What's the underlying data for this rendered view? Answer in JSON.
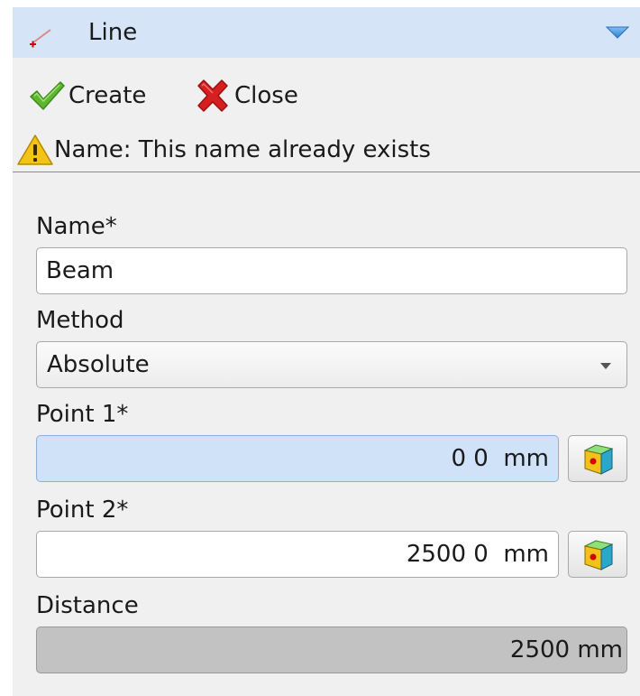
{
  "header": {
    "title": "Line",
    "icon": "line-icon",
    "collapse_icon": "collapse-arrow-icon"
  },
  "toolbar": {
    "create_label": "Create",
    "close_label": "Close"
  },
  "warning": {
    "text": "Name: This name already exists",
    "icon": "warning-icon"
  },
  "form": {
    "name": {
      "label": "Name*",
      "value": "Beam"
    },
    "method": {
      "label": "Method",
      "selected": "Absolute"
    },
    "point1": {
      "label": "Point 1*",
      "value": "0 0  mm"
    },
    "point2": {
      "label": "Point 2*",
      "value": "2500 0  mm"
    },
    "distance": {
      "label": "Distance",
      "value": "2500  mm"
    }
  },
  "colors": {
    "header_bg": "#d6e4f7",
    "panel_bg": "#f0f0f0",
    "active_input_bg": "#cfe2f7",
    "readonly_bg": "#c2c2c2",
    "accent_blue": "#3a8fdc"
  }
}
